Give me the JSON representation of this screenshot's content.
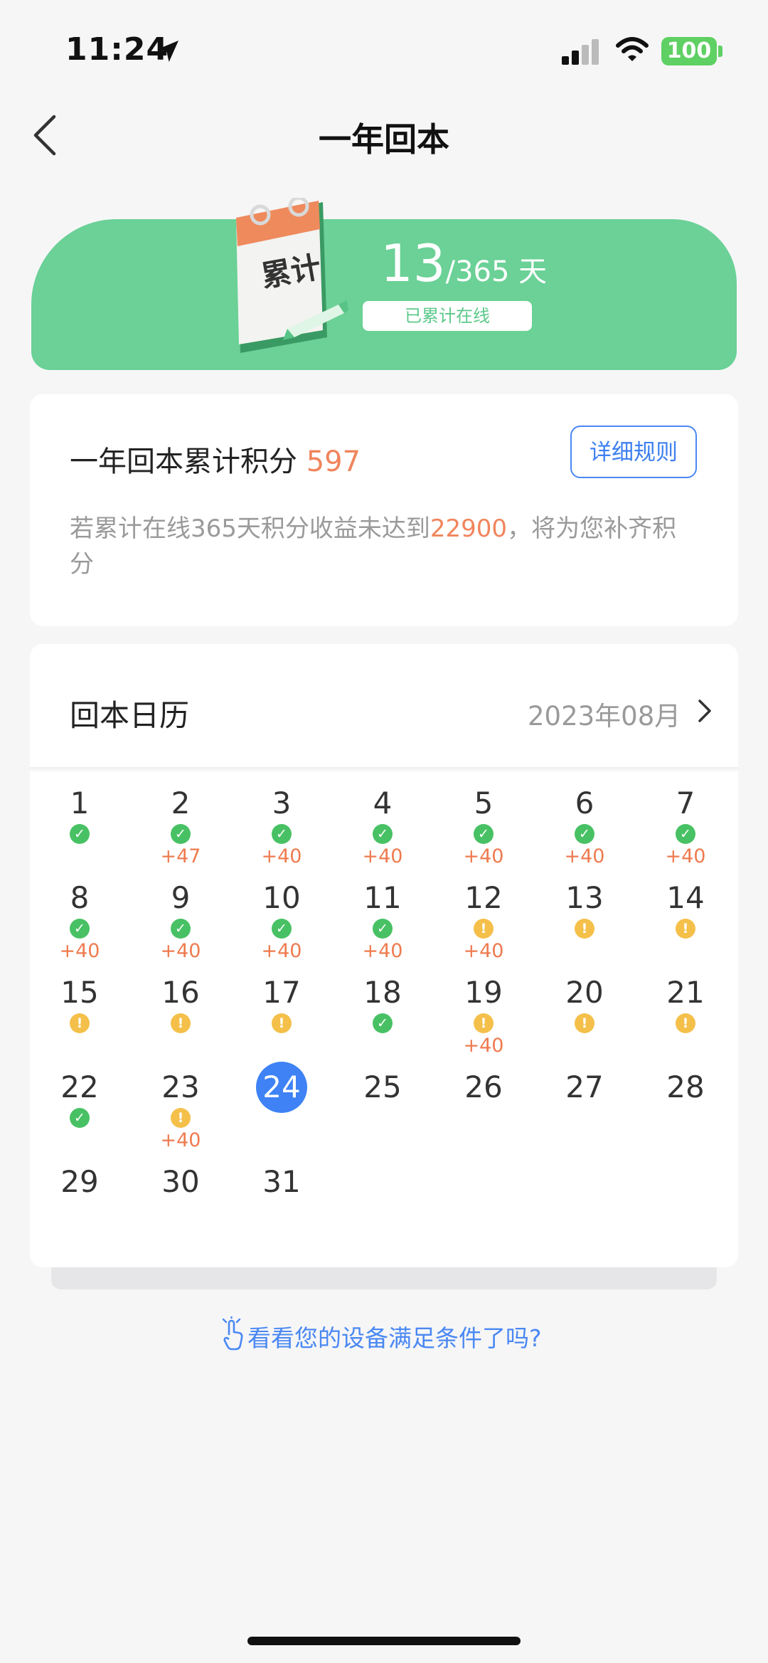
{
  "status_bar": {
    "time": "11:24",
    "battery": "100"
  },
  "header": {
    "title": "一年回本"
  },
  "banner": {
    "days_count": "13",
    "days_total": "/365 天",
    "subtitle": "已累计在线",
    "illustration_text": "累计"
  },
  "points": {
    "label": "一年回本累计积分",
    "value": "597",
    "rules_button": "详细规则",
    "desc_prefix": "若累计在线365天积分收益未达到",
    "desc_amount": "22900",
    "desc_suffix": "，将为您补齐积分"
  },
  "calendar": {
    "title": "回本日历",
    "month": "2023年08月",
    "days": [
      {
        "d": "1",
        "s": "ok",
        "b": ""
      },
      {
        "d": "2",
        "s": "ok",
        "b": "+47"
      },
      {
        "d": "3",
        "s": "ok",
        "b": "+40"
      },
      {
        "d": "4",
        "s": "ok",
        "b": "+40"
      },
      {
        "d": "5",
        "s": "ok",
        "b": "+40"
      },
      {
        "d": "6",
        "s": "ok",
        "b": "+40"
      },
      {
        "d": "7",
        "s": "ok",
        "b": "+40"
      },
      {
        "d": "8",
        "s": "ok",
        "b": "+40"
      },
      {
        "d": "9",
        "s": "ok",
        "b": "+40"
      },
      {
        "d": "10",
        "s": "ok",
        "b": "+40"
      },
      {
        "d": "11",
        "s": "ok",
        "b": "+40"
      },
      {
        "d": "12",
        "s": "warn",
        "b": "+40"
      },
      {
        "d": "13",
        "s": "warn",
        "b": ""
      },
      {
        "d": "14",
        "s": "warn",
        "b": ""
      },
      {
        "d": "15",
        "s": "warn",
        "b": ""
      },
      {
        "d": "16",
        "s": "warn",
        "b": ""
      },
      {
        "d": "17",
        "s": "warn",
        "b": ""
      },
      {
        "d": "18",
        "s": "ok",
        "b": ""
      },
      {
        "d": "19",
        "s": "warn",
        "b": "+40"
      },
      {
        "d": "20",
        "s": "warn",
        "b": ""
      },
      {
        "d": "21",
        "s": "warn",
        "b": ""
      },
      {
        "d": "22",
        "s": "ok",
        "b": ""
      },
      {
        "d": "23",
        "s": "warn",
        "b": "+40"
      },
      {
        "d": "24",
        "s": "today",
        "b": ""
      },
      {
        "d": "25",
        "s": "",
        "b": ""
      },
      {
        "d": "26",
        "s": "",
        "b": ""
      },
      {
        "d": "27",
        "s": "",
        "b": ""
      },
      {
        "d": "28",
        "s": "",
        "b": ""
      },
      {
        "d": "29",
        "s": "",
        "b": ""
      },
      {
        "d": "30",
        "s": "",
        "b": ""
      },
      {
        "d": "31",
        "s": "",
        "b": ""
      }
    ]
  },
  "footer": {
    "check_link": "看看您的设备满足条件了吗?"
  },
  "icons": {
    "back": "chevron-left-icon",
    "location": "location-arrow-icon",
    "next_month": "chevron-right-icon",
    "ok": "check-circle-icon",
    "warn": "exclamation-circle-icon",
    "hand": "pointer-hand-icon"
  },
  "colors": {
    "banner": "#6bd196",
    "accent_orange": "#f0855d",
    "accent_blue": "#3e82f5",
    "ok_green": "#48c164",
    "warn_yellow": "#f4c04a"
  }
}
